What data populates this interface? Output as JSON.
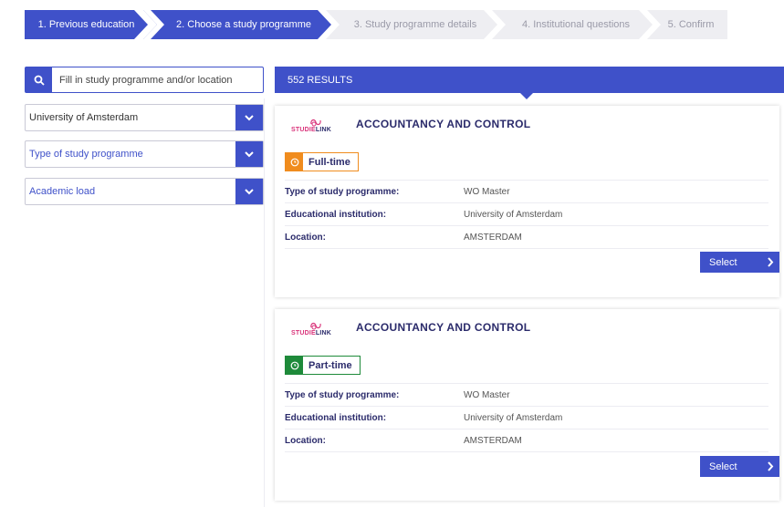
{
  "steps": [
    {
      "label": "1. Previous education",
      "state": "done"
    },
    {
      "label": "2. Choose a study programme",
      "state": "active"
    },
    {
      "label": "3. Study programme details",
      "state": "todo"
    },
    {
      "label": "4. Institutional questions",
      "state": "todo"
    },
    {
      "label": "5. Confirm",
      "state": "todo"
    }
  ],
  "search": {
    "placeholder": "Fill in study programme and/or location",
    "icon": "search-icon"
  },
  "filters": {
    "institution": "University of Amsterdam",
    "programme_type": "Type of study programme",
    "academic_load": "Academic load"
  },
  "results": {
    "count_label": "552 RESULTS",
    "items": [
      {
        "logo_text": "STUDIELINK",
        "title": "ACCOUNTANCY AND CONTROL",
        "tag": "Full-time",
        "tag_color": "#f08c1e",
        "rows": [
          {
            "k": "Type of study programme:",
            "v": "WO Master"
          },
          {
            "k": "Educational institution:",
            "v": "University of Amsterdam"
          },
          {
            "k": "Location:",
            "v": "AMSTERDAM"
          }
        ],
        "select_label": "Select"
      },
      {
        "logo_text": "STUDIELINK",
        "title": "ACCOUNTANCY AND CONTROL",
        "tag": "Part-time",
        "tag_color": "#1e8a3a",
        "rows": [
          {
            "k": "Type of study programme:",
            "v": "WO Master"
          },
          {
            "k": "Educational institution:",
            "v": "University of Amsterdam"
          },
          {
            "k": "Location:",
            "v": "AMSTERDAM"
          }
        ],
        "select_label": "Select"
      }
    ]
  },
  "colors": {
    "primary": "#3f51c9",
    "step_inactive": "#eeeef2",
    "text_dark": "#2b2b6b"
  }
}
